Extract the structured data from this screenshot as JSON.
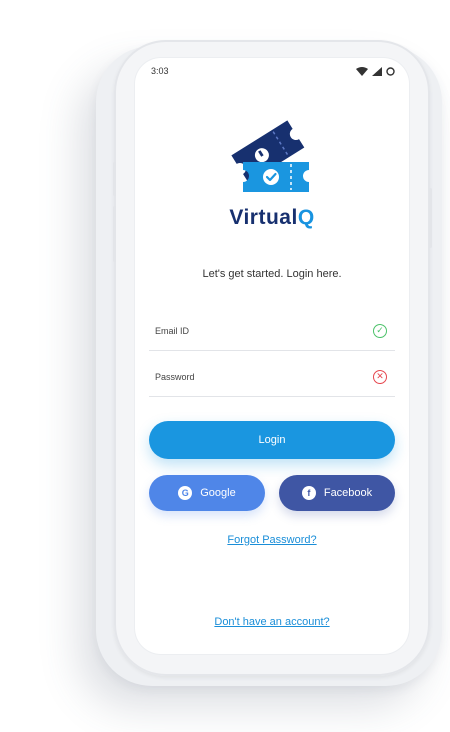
{
  "status_bar": {
    "time": "3:03",
    "icons": [
      "wifi-icon",
      "signal-icon",
      "battery-icon"
    ]
  },
  "brand": {
    "name_part1": "Virtual",
    "name_part2": "Q"
  },
  "tagline": "Let's get started. Login here.",
  "form": {
    "email": {
      "label": "Email ID",
      "status": "valid",
      "status_icon": "check-circle-icon"
    },
    "password": {
      "label": "Password",
      "status": "invalid",
      "status_icon": "x-circle-icon"
    }
  },
  "buttons": {
    "login": "Login",
    "google": "Google",
    "facebook": "Facebook"
  },
  "links": {
    "forgot_password": "Forgot Password?",
    "no_account": "Don't have an account?"
  },
  "colors": {
    "brand_dark": "#17306f",
    "accent": "#1a96e0",
    "google": "#4f86e8",
    "facebook": "#3f56a4",
    "valid": "#4cc26a",
    "invalid": "#e6474f"
  }
}
